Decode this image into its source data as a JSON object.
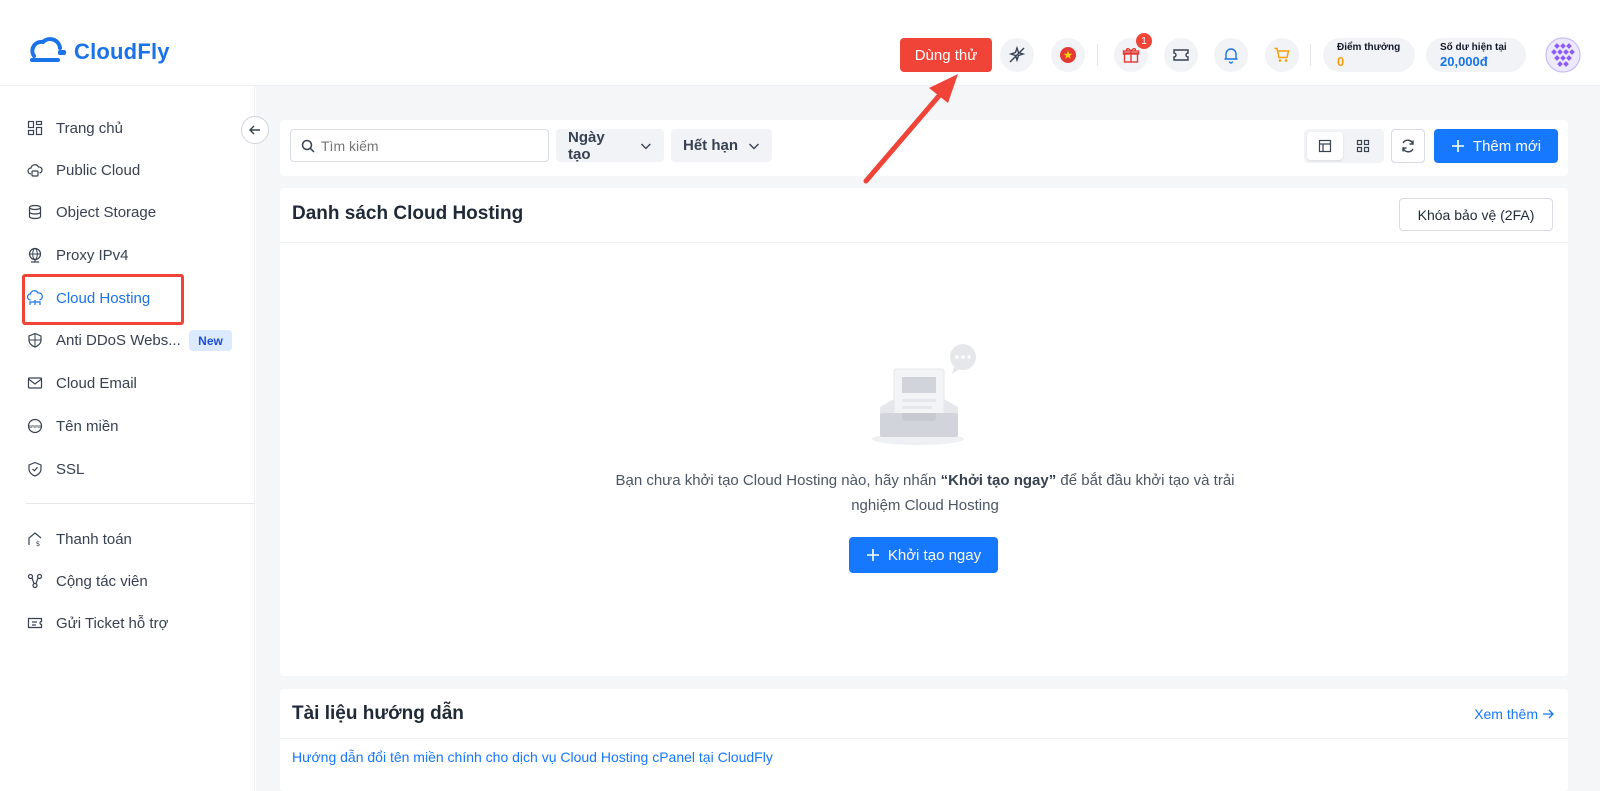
{
  "brand": {
    "name": "CloudFly",
    "color": "#1a73e8"
  },
  "header": {
    "trial_label": "Dùng thử",
    "gift_badge": "1",
    "points": {
      "label": "Điểm thưởng",
      "value": "0",
      "color": "#f59e0b"
    },
    "balance": {
      "label": "Số dư hiện tại",
      "value": "20,000đ",
      "color": "#1a73e8"
    },
    "icons": [
      "sparkle-off-icon",
      "flag-vn-icon",
      "gift-icon",
      "ticket-icon",
      "bell-icon",
      "cart-icon"
    ]
  },
  "sidebar": {
    "items": [
      {
        "label": "Trang chủ",
        "icon": "dashboard-icon"
      },
      {
        "label": "Public Cloud",
        "icon": "cloud-icon"
      },
      {
        "label": "Object Storage",
        "icon": "database-icon"
      },
      {
        "label": "Proxy IPv4",
        "icon": "globe-icon"
      },
      {
        "label": "Cloud Hosting",
        "icon": "cloud-hosting-icon",
        "active": true
      },
      {
        "label": "Anti DDoS Webs...",
        "icon": "shield-globe-icon",
        "badge": "New"
      },
      {
        "label": "Cloud Email",
        "icon": "mail-icon"
      },
      {
        "label": "Tên miền",
        "icon": "www-icon"
      },
      {
        "label": "SSL",
        "icon": "shield-check-icon"
      }
    ],
    "items2": [
      {
        "label": "Thanh toán",
        "icon": "payment-icon"
      },
      {
        "label": "Cộng tác viên",
        "icon": "affiliate-icon"
      },
      {
        "label": "Gửi Ticket hỗ trợ",
        "icon": "ticket-support-icon"
      }
    ]
  },
  "toolbar": {
    "search_placeholder": "Tìm kiếm",
    "filter_created": "Ngày tạo",
    "filter_expired": "Hết hạn",
    "add_label": "Thêm mới"
  },
  "list": {
    "title": "Danh sách Cloud Hosting",
    "twofa_label": "Khóa bảo vệ (2FA)",
    "empty_prefix": "Bạn chưa khởi tạo Cloud Hosting nào, hãy nhấn ",
    "empty_bold": "“Khởi tạo ngay”",
    "empty_suffix": " để bắt đầu khởi tạo và trải nghiệm Cloud Hosting",
    "create_label": "Khởi tạo ngay"
  },
  "docs": {
    "title": "Tài liệu hướng dẫn",
    "see_more": "Xem thêm",
    "links": [
      "Hướng dẫn đổi tên miền chính cho dịch vụ Cloud Hosting cPanel tại CloudFly"
    ]
  },
  "annotation_color": "#f04438"
}
